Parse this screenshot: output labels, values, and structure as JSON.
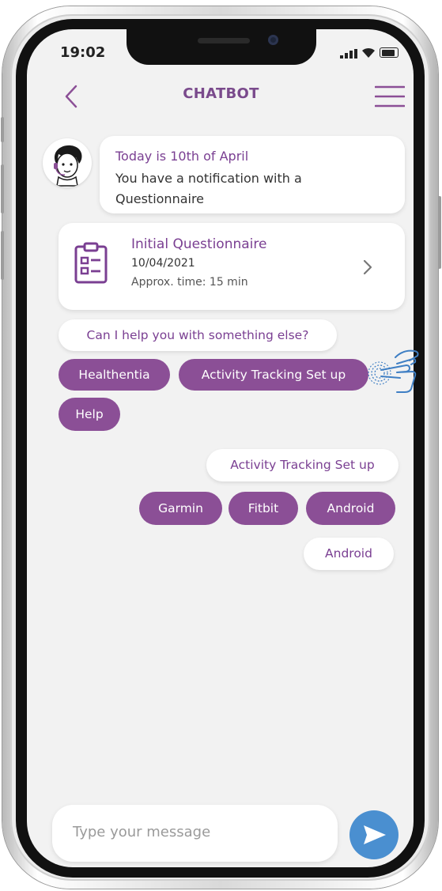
{
  "status_bar": {
    "time": "19:02"
  },
  "header": {
    "title": "CHATBOT",
    "back_icon": "chevron-left-icon",
    "menu_icon": "hamburger-menu-icon"
  },
  "bot_message": {
    "title": "Today is 10th of April",
    "body": "You have a notification with a Questionnaire"
  },
  "questionnaire_card": {
    "title": "Initial Questionnaire",
    "date": "10/04/2021",
    "approx_time": "Approx. time: 15 min",
    "icon": "clipboard-icon"
  },
  "help_prompt": "Can I help you with something else?",
  "quick_replies": [
    {
      "label": "Healthentia"
    },
    {
      "label": "Activity Tracking Set up"
    },
    {
      "label": "Help"
    }
  ],
  "user_reply_1": "Activity Tracking Set up",
  "device_options": [
    {
      "label": "Garmin"
    },
    {
      "label": "Fitbit"
    },
    {
      "label": "Android"
    }
  ],
  "user_reply_2": "Android",
  "composer": {
    "placeholder": "Type your message",
    "send_icon": "send-icon"
  },
  "colors": {
    "accent_purple": "#8b4f96",
    "title_purple": "#7a3f92",
    "send_blue": "#4a8fd0",
    "screen_bg": "#f2f2f2"
  }
}
